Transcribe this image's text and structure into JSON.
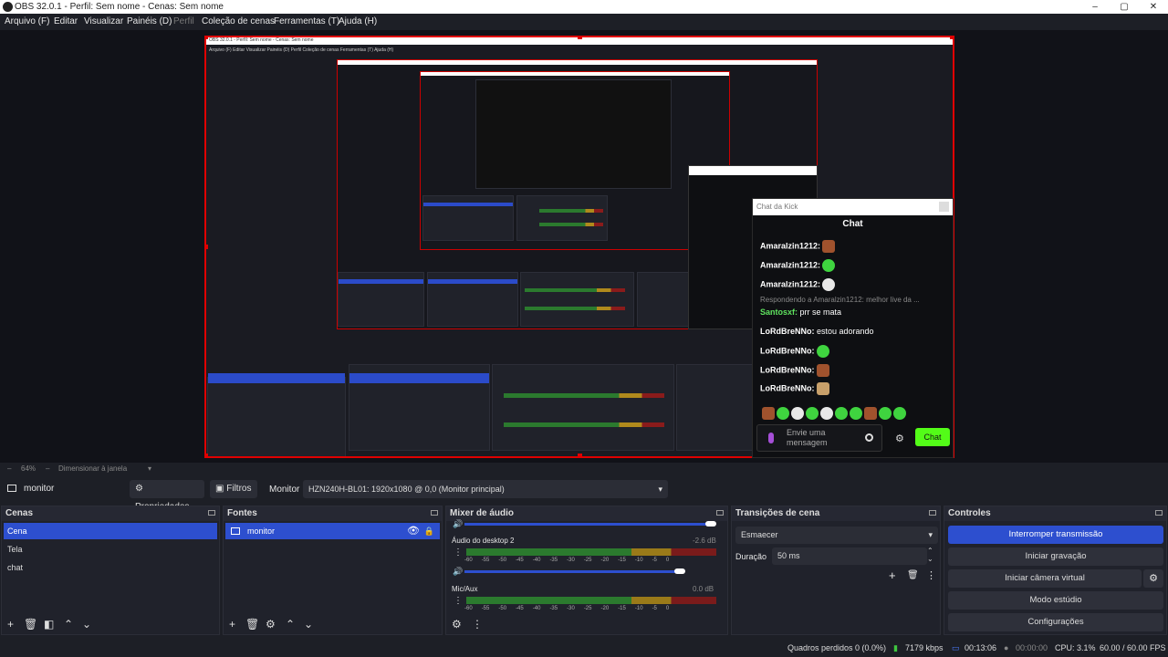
{
  "window": {
    "title": "OBS 32.0.1 - Perfil: Sem nome - Cenas: Sem nome",
    "minimize": "–",
    "maximize": "▢",
    "close": "✕"
  },
  "menu": [
    "Arquivo (F)",
    "Editar",
    "Visualizar",
    "Painéis (D)",
    "Perfil",
    "Coleção de cenas",
    "Ferramentas (T)",
    "Ajuda (H)"
  ],
  "chat": {
    "header": "Chat da Kick",
    "title": "Chat",
    "messages": [
      {
        "user": "Amaralzin1212:",
        "text": ""
      },
      {
        "user": "Amaralzin1212:",
        "text": ""
      },
      {
        "user": "Amaralzin1212:",
        "text": ""
      },
      {
        "reply": "Respondendo a Amaralzin1212: melhor live da ..."
      },
      {
        "user": "Santosxf:",
        "text": "prr se mata"
      },
      {
        "user": "LoRdBreNNo:",
        "text": "estou adorando"
      },
      {
        "user": "LoRdBreNNo:",
        "text": ""
      },
      {
        "user": "LoRdBreNNo:",
        "text": ""
      },
      {
        "user": "LoRdBreNNo:",
        "text": ""
      }
    ],
    "input_placeholder": "Envie uma mensagem",
    "send": "Chat"
  },
  "preview_bar": {
    "zoom": "64%",
    "resize": "Dimensionar à janela",
    "dash": "–"
  },
  "source_toolbar": {
    "source": "monitor",
    "properties": "Propriedades",
    "filters": "Filtros",
    "monitor_label": "Monitor",
    "monitor_value": "HZN240H-BL01: 1920x1080 @ 0,0 (Monitor principal)"
  },
  "scenes": {
    "title": "Cenas",
    "items": [
      "Cena",
      "Tela",
      "chat"
    ],
    "selected": 0
  },
  "sources": {
    "title": "Fontes",
    "items": [
      "monitor"
    ]
  },
  "mixer": {
    "title": "Mixer de áudio",
    "channels": [
      {
        "name": "Áudio do desktop 2",
        "db": "-2.6 dB"
      },
      {
        "name": "Mic/Aux",
        "db": "0.0 dB"
      }
    ],
    "scale": [
      "-60",
      "-55",
      "-50",
      "-45",
      "-40",
      "-35",
      "-30",
      "-25",
      "-20",
      "-15",
      "-10",
      "-5",
      "0"
    ]
  },
  "transitions": {
    "title": "Transições de cena",
    "type": "Esmaecer",
    "duration_label": "Duração",
    "duration": "50 ms"
  },
  "controls": {
    "title": "Controles",
    "buttons": [
      "Interromper transmissão",
      "Iniciar gravação",
      "Iniciar câmera virtual",
      "Modo estúdio",
      "Configurações"
    ]
  },
  "status": {
    "dropped": "Quadros perdidos 0 (0.0%)",
    "kbps": "7179 kbps",
    "stream_time": "00:13:06",
    "rec_time": "00:00:00",
    "cpu": "CPU: 3.1%",
    "fps": "60.00 / 60.00 FPS"
  },
  "nested": {
    "title": "OBS 32.0.1 - Perfil: Sem nome - Cenas: Sem nome",
    "menu": "Arquivo (F)   Editar   Visualizar   Painéis (D)   Perfil   Coleção de cenas   Ferramentas (T)   Ajuda (H)"
  },
  "colors": {
    "accent": "#2d4fcf",
    "recording_border": "#e00000",
    "kick_green": "#53fc18"
  }
}
